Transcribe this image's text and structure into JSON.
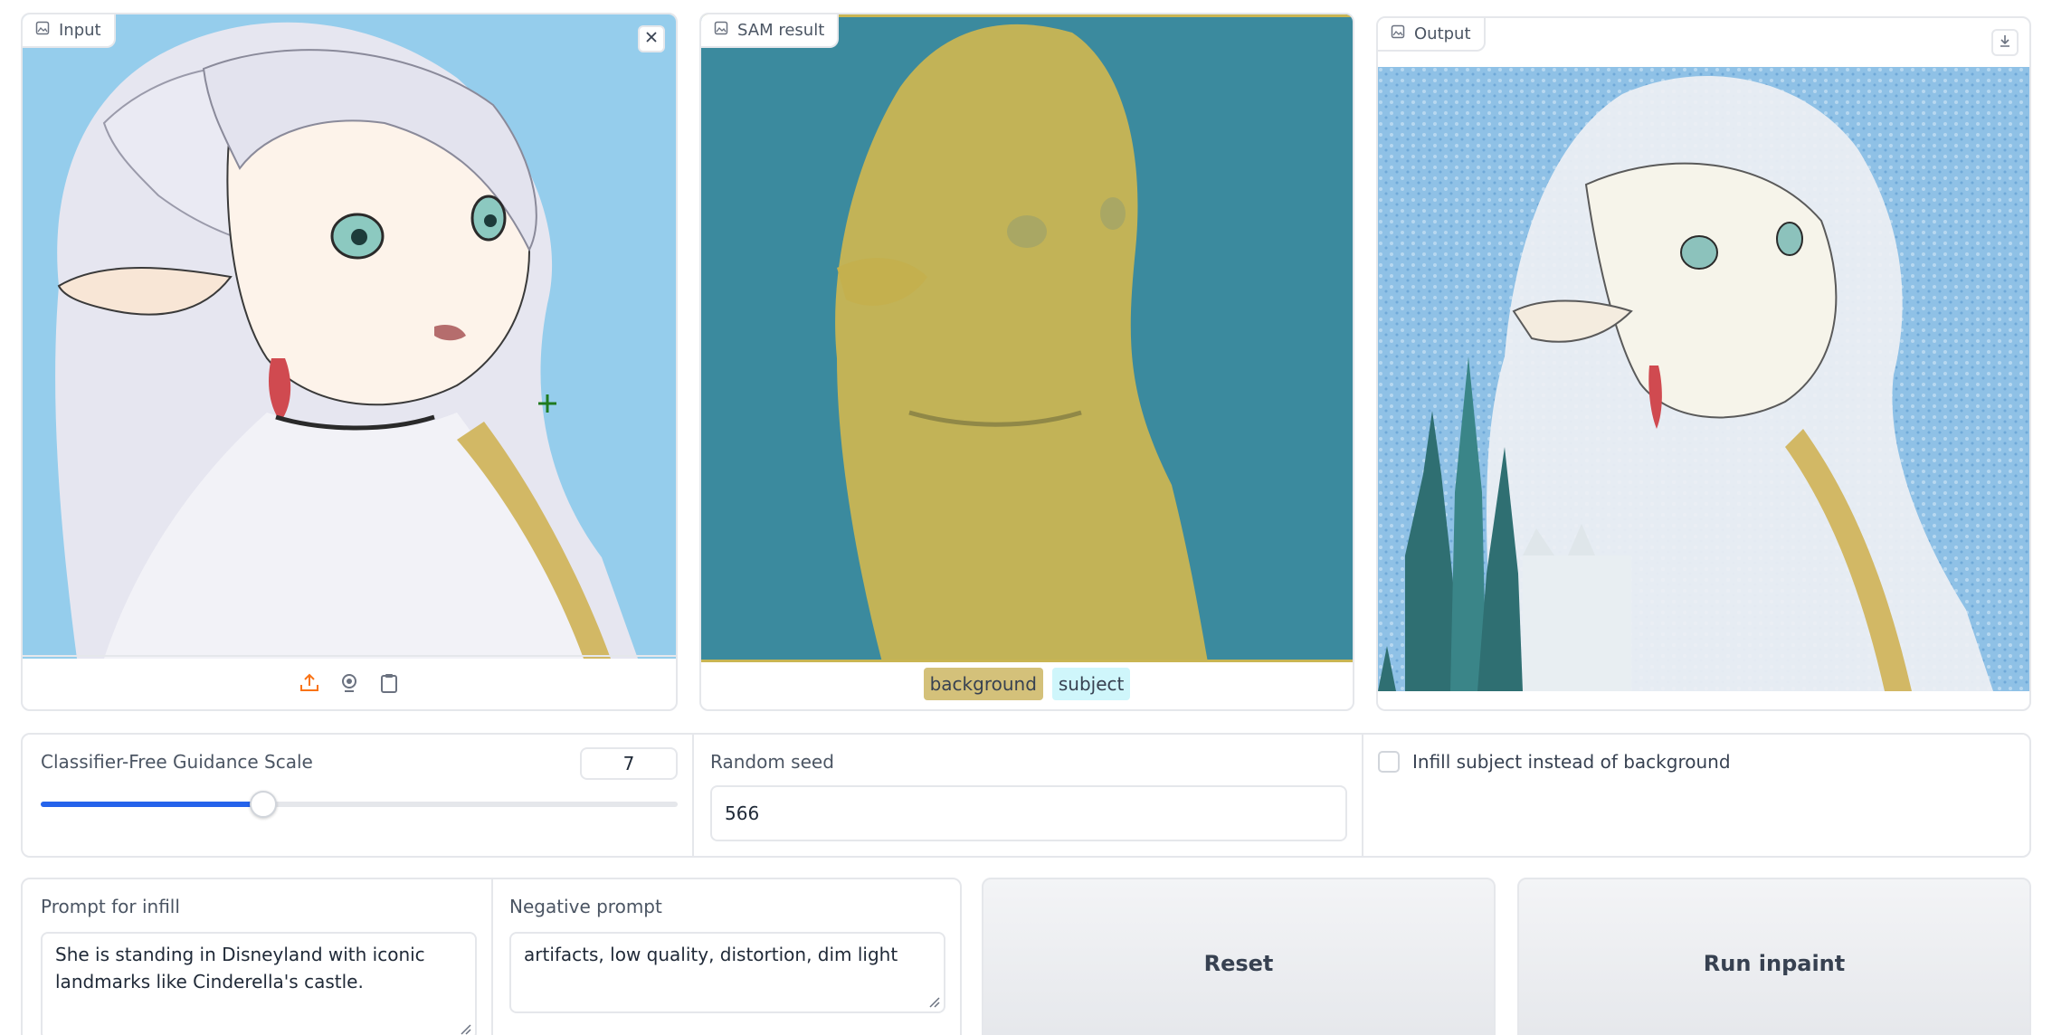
{
  "input_panel": {
    "label": "Input",
    "icons": {
      "label": "image-icon",
      "clear": "close-icon",
      "sources": [
        "upload-icon",
        "webcam-icon",
        "clipboard-icon"
      ]
    }
  },
  "sam_panel": {
    "label": "SAM result",
    "legend": [
      {
        "label": "background",
        "color": "#d4c17a"
      },
      {
        "label": "subject",
        "color": "#cff6fb"
      }
    ]
  },
  "output_panel": {
    "label": "Output",
    "icons": {
      "download": "download-icon"
    }
  },
  "controls": {
    "cfg": {
      "label": "Classifier-Free Guidance Scale",
      "value": "7",
      "fraction": 0.35
    },
    "seed": {
      "label": "Random seed",
      "value": "566"
    },
    "infill": {
      "label": "Infill subject instead of background",
      "checked": false
    }
  },
  "prompt": {
    "label": "Prompt for infill",
    "value": "She is standing in Disneyland with iconic landmarks like Cinderella's castle."
  },
  "negative_prompt": {
    "label": "Negative prompt",
    "value": "artifacts, low quality, distortion, dim light"
  },
  "buttons": {
    "reset": "Reset",
    "run": "Run inpaint"
  },
  "colors": {
    "accent": "#2563eb",
    "sam_background": "#3b8a9e",
    "sam_subject": "#c9b553",
    "sky": "#95cdec",
    "upload_accent": "#f97316"
  }
}
